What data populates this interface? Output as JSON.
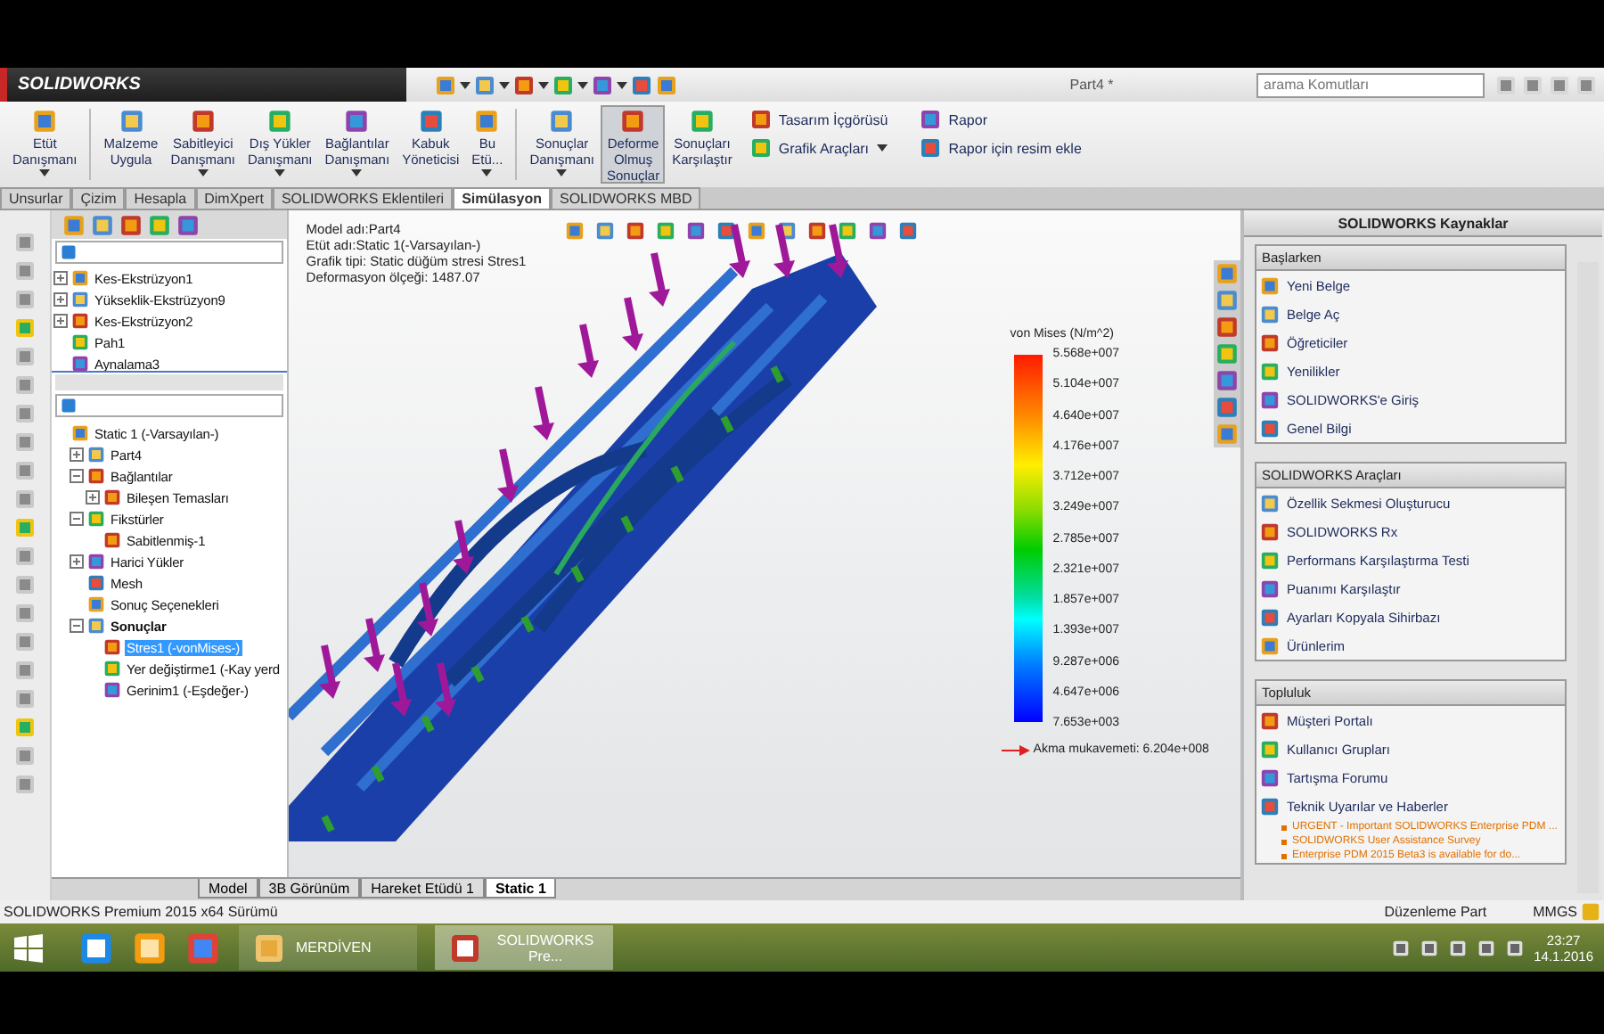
{
  "app": {
    "logo": "SOLIDWORKS",
    "document_title": "Part4 *",
    "search": {
      "placeholder": "arama Komutları"
    }
  },
  "ribbon": {
    "buttons": [
      {
        "label": "Etüt\nDanışmanı",
        "dropdown": true,
        "selected": false
      },
      {
        "label": "Malzeme\nUygula",
        "dropdown": false,
        "selected": false
      },
      {
        "label": "Sabitleyici\nDanışmanı",
        "dropdown": true,
        "selected": false
      },
      {
        "label": "Dış Yükler\nDanışmanı",
        "dropdown": true,
        "selected": false
      },
      {
        "label": "Bağlantılar\nDanışmanı",
        "dropdown": true,
        "selected": false
      },
      {
        "label": "Kabuk\nYöneticisi",
        "dropdown": false,
        "selected": false
      },
      {
        "label": "Bu\nEtü...",
        "dropdown": true,
        "selected": false
      },
      {
        "label": "Sonuçlar\nDanışmanı",
        "dropdown": true,
        "selected": false
      },
      {
        "label": "Deforme\nOlmuş\nSonuçlar",
        "dropdown": false,
        "selected": true
      },
      {
        "label": "Sonuçları\nKarşılaştır",
        "dropdown": false,
        "selected": false
      }
    ],
    "small_buttons": [
      {
        "label": "Tasarım İçgörüsü",
        "dropdown": false
      },
      {
        "label": "Grafik Araçları",
        "dropdown": true
      },
      {
        "label": "Rapor",
        "dropdown": false
      },
      {
        "label": "Rapor için resim ekle",
        "dropdown": false
      }
    ]
  },
  "tabs": [
    {
      "label": "Unsurlar",
      "selected": false
    },
    {
      "label": "Çizim",
      "selected": false
    },
    {
      "label": "Hesapla",
      "selected": false
    },
    {
      "label": "DimXpert",
      "selected": false
    },
    {
      "label": "SOLIDWORKS Eklentileri",
      "selected": false
    },
    {
      "label": "Simülasyon",
      "selected": true
    },
    {
      "label": "SOLIDWORKS MBD",
      "selected": false
    }
  ],
  "feature_list": [
    {
      "label": "Kes-Ekstrüzyon1",
      "expanded": false,
      "selected": false
    },
    {
      "label": "Yükseklik-Ekstrüzyon9",
      "expanded": false,
      "selected": false
    },
    {
      "label": "Kes-Ekstrüzyon2",
      "expanded": false,
      "selected": false
    },
    {
      "label": "Pah1",
      "selected": false
    },
    {
      "label": "Aynalama3",
      "selected": false
    }
  ],
  "study_tree": [
    {
      "label": "Static 1 (-Varsayılan-)",
      "selected": false,
      "children": [
        {
          "label": "Part4",
          "expanded": false,
          "selected": false
        },
        {
          "label": "Bağlantılar",
          "expanded": true,
          "selected": false,
          "children": [
            {
              "label": "Bileşen Temasları",
              "expanded": false,
              "selected": false
            }
          ]
        },
        {
          "label": "Fikstürler",
          "expanded": true,
          "selected": false,
          "children": [
            {
              "label": "Sabitlenmiş-1",
              "selected": false
            }
          ]
        },
        {
          "label": "Harici Yükler",
          "expanded": false,
          "selected": false
        },
        {
          "label": "Mesh",
          "selected": false
        },
        {
          "label": "Sonuç Seçenekleri",
          "selected": false
        },
        {
          "label": "Sonuçlar",
          "expanded": true,
          "selected": false,
          "bold": true,
          "children": [
            {
              "label": "Stres1 (-vonMises-)",
              "selected": true
            },
            {
              "label": "Yer değiştirme1 (-Kay yerd",
              "selected": false
            },
            {
              "label": "Gerinim1 (-Eşdeğer-)",
              "selected": false
            }
          ]
        }
      ]
    }
  ],
  "viewport": {
    "info": [
      "Model adı:Part4",
      "Etüt adı:Static 1(-Varsayılan-)",
      "Grafik tipi: Static düğüm stresi Stres1",
      "Deformasyon ölçeği: 1487.07"
    ],
    "legend": {
      "title": "von Mises (N/m^2)",
      "labels": [
        "5.568e+007",
        "5.104e+007",
        "4.640e+007",
        "4.176e+007",
        "3.712e+007",
        "3.249e+007",
        "2.785e+007",
        "2.321e+007",
        "1.857e+007",
        "1.393e+007",
        "9.287e+006",
        "4.647e+006",
        "7.653e+003"
      ],
      "yield": "Akma mukavemeti: 6.204e+008"
    }
  },
  "bottom_tabs": [
    {
      "label": "Model",
      "selected": false
    },
    {
      "label": "3B Görünüm",
      "selected": false
    },
    {
      "label": "Hareket Etüdü 1",
      "selected": false
    },
    {
      "label": "Static 1",
      "selected": true
    }
  ],
  "task_pane": {
    "title": "SOLIDWORKS Kaynaklar",
    "sections": [
      {
        "title": "Başlarken",
        "items": [
          "Yeni Belge",
          "Belge Aç",
          "Öğreticiler",
          "Yenilikler",
          "SOLIDWORKS'e Giriş",
          "Genel Bilgi"
        ]
      },
      {
        "title": "SOLIDWORKS Araçları",
        "items": [
          "Özellik Sekmesi Oluşturucu",
          "SOLIDWORKS Rx",
          "Performans Karşılaştırma Testi",
          "Puanımı Karşılaştır",
          "Ayarları Kopyala Sihirbazı",
          "Ürünlerim"
        ]
      },
      {
        "title": "Topluluk",
        "items": [
          "Müşteri Portalı",
          "Kullanıcı Grupları",
          "Tartışma Forumu",
          "Teknik Uyarılar ve Haberler"
        ],
        "news": [
          "URGENT - Important SOLIDWORKS Enterprise PDM ...",
          "SOLIDWORKS User Assistance Survey",
          "Enterprise PDM 2015 Beta3 is available for do..."
        ]
      }
    ]
  },
  "status_bar": {
    "version": "SOLIDWORKS Premium 2015 x64 Sürümü",
    "mode": "Düzenleme Part",
    "units": "MMGS"
  },
  "taskbar": {
    "apps": [
      {
        "label": "MERDİVEN",
        "selected": false
      },
      {
        "label": "SOLIDWORKS Pre...",
        "selected": true
      }
    ],
    "time": "23:27",
    "date": "14.1.2016"
  }
}
